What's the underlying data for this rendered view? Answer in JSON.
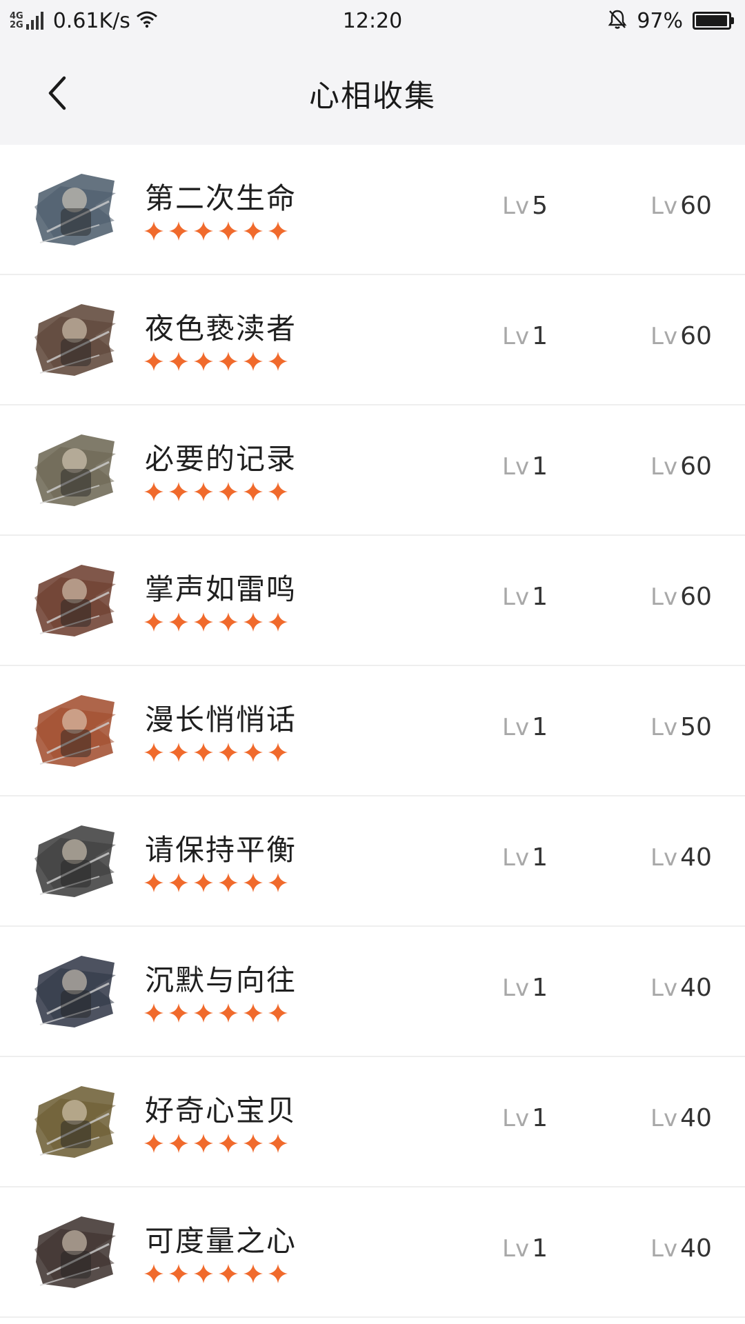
{
  "status_bar": {
    "network_top": "4G",
    "network_bottom": "2G",
    "speed": "0.61K/s",
    "time": "12:20",
    "battery_percent": "97%",
    "battery_level": 0.97
  },
  "header": {
    "title": "心相收集",
    "back_icon": "chevron-left-icon"
  },
  "colors": {
    "star": "#f06a2c",
    "background_header": "#f4f4f6",
    "divider": "#eeeeee"
  },
  "level_prefix": "Lv",
  "items": [
    {
      "name": "第二次生命",
      "stars": 6,
      "current_level": "5",
      "max_level": "60",
      "avatar_tint": "#4a5a6a"
    },
    {
      "name": "夜色亵渎者",
      "stars": 6,
      "current_level": "1",
      "max_level": "60",
      "avatar_tint": "#5a4234"
    },
    {
      "name": "必要的记录",
      "stars": 6,
      "current_level": "1",
      "max_level": "60",
      "avatar_tint": "#6a6450"
    },
    {
      "name": "掌声如雷鸣",
      "stars": 6,
      "current_level": "1",
      "max_level": "60",
      "avatar_tint": "#6a3a2a"
    },
    {
      "name": "漫长悄悄话",
      "stars": 6,
      "current_level": "1",
      "max_level": "50",
      "avatar_tint": "#a04a2a"
    },
    {
      "name": "请保持平衡",
      "stars": 6,
      "current_level": "1",
      "max_level": "40",
      "avatar_tint": "#3a3a3a"
    },
    {
      "name": "沉默与向往",
      "stars": 6,
      "current_level": "1",
      "max_level": "40",
      "avatar_tint": "#2e3444"
    },
    {
      "name": "好奇心宝贝",
      "stars": 6,
      "current_level": "1",
      "max_level": "40",
      "avatar_tint": "#6a5a30"
    },
    {
      "name": "可度量之心",
      "stars": 6,
      "current_level": "1",
      "max_level": "40",
      "avatar_tint": "#3a2e2a"
    }
  ]
}
